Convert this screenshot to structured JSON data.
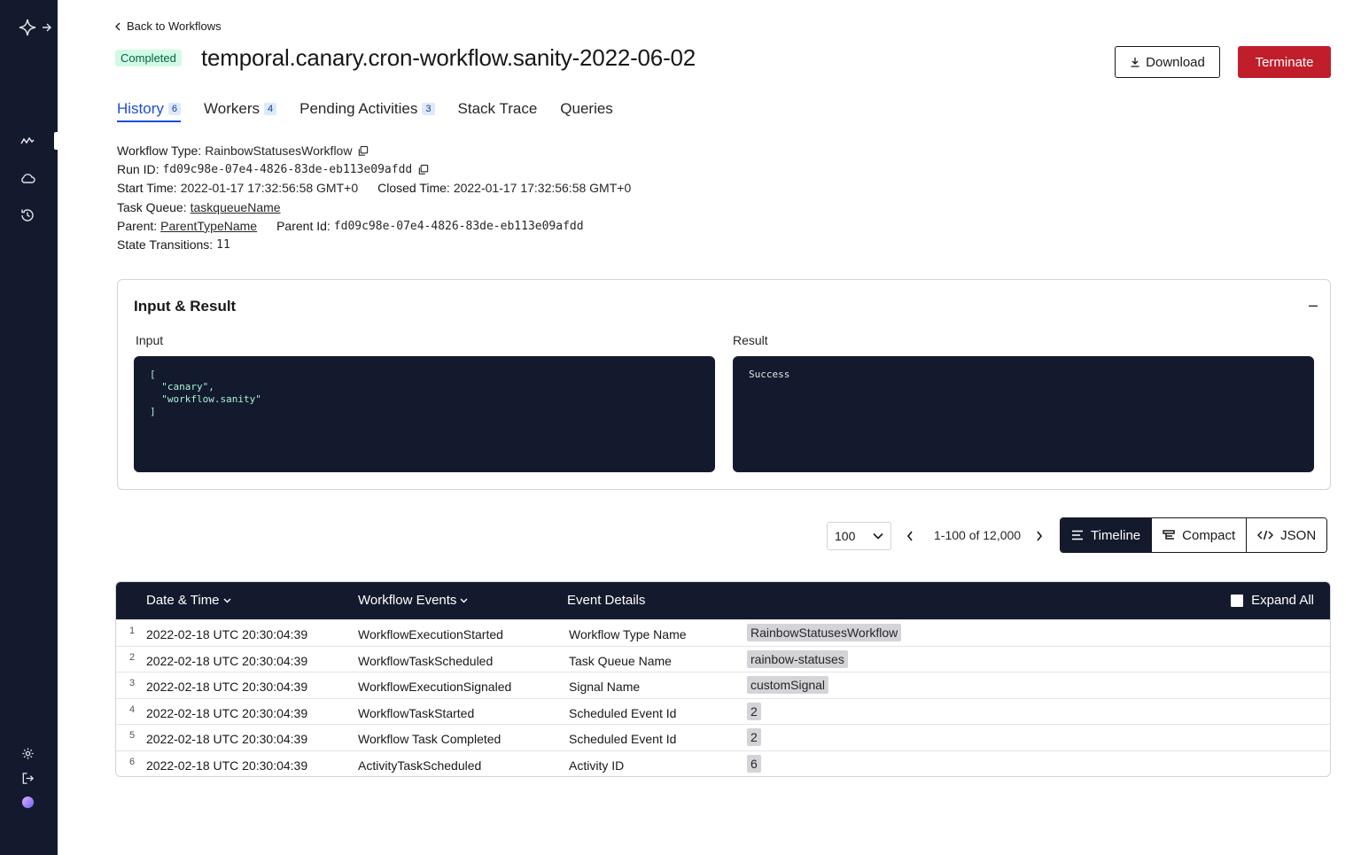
{
  "nav": {
    "back_label": "Back to Workflows"
  },
  "workflow": {
    "status": "Completed",
    "title": "temporal.canary.cron-workflow.sanity-2022-06-02",
    "download_label": "Download",
    "terminate_label": "Terminate"
  },
  "tabs": [
    {
      "label": "History",
      "count": "6"
    },
    {
      "label": "Workers",
      "count": "4"
    },
    {
      "label": "Pending Activities",
      "count": "3"
    },
    {
      "label": "Stack Trace",
      "count": ""
    },
    {
      "label": "Queries",
      "count": ""
    }
  ],
  "summary": {
    "workflow_type_label": "Workflow Type:",
    "workflow_type": "RainbowStatusesWorkflow",
    "run_id_label": "Run ID:",
    "run_id": "fd09c98e-07e4-4826-83de-eb113e09afdd",
    "start_time_label": "Start Time:",
    "start_time": "2022-01-17 17:32:56:58 GMT+0",
    "closed_time_label": "Closed Time:",
    "closed_time": "2022-01-17 17:32:56:58 GMT+0",
    "task_queue_label": "Task Queue:",
    "task_queue": "taskqueueName",
    "parent_label": "Parent:",
    "parent": "ParentTypeName",
    "parent_id_label": "Parent Id:",
    "parent_id": "fd09c98e-07e4-4826-83de-eb113e09afdd",
    "state_transitions_label": "State Transitions:",
    "state_transitions": "11"
  },
  "input_result": {
    "title": "Input & Result",
    "collapse_symbol": "–",
    "input_label": "Input",
    "input_code": "[\n  \"canary\",\n  \"workflow.sanity\"\n]",
    "result_label": "Result",
    "result_code": "Success"
  },
  "pager": {
    "page_size": "100",
    "range_text": "1-100 of 12,000"
  },
  "views": {
    "timeline": "Timeline",
    "compact": "Compact",
    "json": "JSON",
    "active": "timeline"
  },
  "events_table": {
    "columns": {
      "date_time": "Date & Time",
      "workflow_events": "Workflow Events",
      "event_details": "Event Details"
    },
    "expand_all_label": "Expand All",
    "rows": [
      {
        "num": "1",
        "time": "2022-02-18 UTC 20:30:04:39",
        "event": "WorkflowExecutionStarted",
        "detail_key": "Workflow Type Name",
        "detail_value": "RainbowStatusesWorkflow"
      },
      {
        "num": "2",
        "time": "2022-02-18 UTC 20:30:04:39",
        "event": "WorkflowTaskScheduled",
        "detail_key": "Task Queue Name",
        "detail_value": "rainbow-statuses"
      },
      {
        "num": "3",
        "time": "2022-02-18 UTC 20:30:04:39",
        "event": "WorkflowExecutionSignaled",
        "detail_key": "Signal Name",
        "detail_value": "customSignal"
      },
      {
        "num": "4",
        "time": "2022-02-18 UTC 20:30:04:39",
        "event": "WorkflowTaskStarted",
        "detail_key": "Scheduled Event Id",
        "detail_value": "2"
      },
      {
        "num": "5",
        "time": "2022-02-18 UTC 20:30:04:39",
        "event": "Workflow Task Completed",
        "detail_key": "Scheduled Event Id",
        "detail_value": "2"
      },
      {
        "num": "6",
        "time": "2022-02-18 UTC 20:30:04:39",
        "event": "ActivityTaskScheduled",
        "detail_key": "Activity ID",
        "detail_value": "6"
      }
    ]
  },
  "colors": {
    "sidebar_bg": "#141a2e",
    "terminate_red": "#c11e2b",
    "active_tab_blue": "#1d4ed8",
    "completed_green": "#d1fae5"
  }
}
